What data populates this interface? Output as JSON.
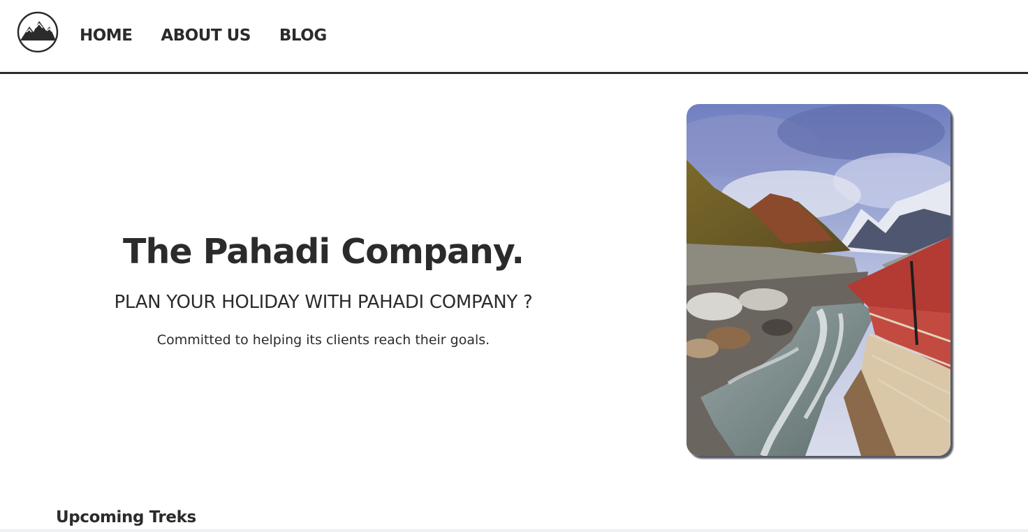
{
  "nav": {
    "logo_icon": "mountain-logo-icon",
    "links": [
      {
        "label": "HOME"
      },
      {
        "label": "ABOUT US"
      },
      {
        "label": "BLOG"
      }
    ]
  },
  "hero": {
    "title": "The Pahadi Company.",
    "subtitle": "PLAN YOUR HOLIDAY WITH PAHADI COMPANY ?",
    "description": "Committed to helping its clients reach their goals.",
    "image_subject": "mountain river with stone steps and cloudy sky"
  },
  "sections": {
    "upcoming_title": "Upcoming Treks"
  },
  "colors": {
    "text": "#2b2b2b",
    "divider": "#2b2b2b",
    "background": "#ffffff",
    "image_shadow": "#555a66"
  }
}
